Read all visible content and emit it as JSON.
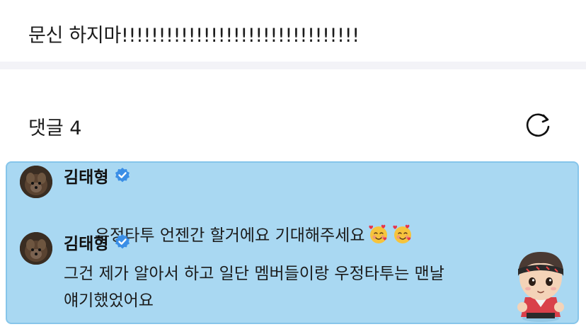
{
  "post": {
    "text": "문신 하지마!!!!!!!!!!!!!!!!!!!!!!!!!!!!!!!!"
  },
  "comments": {
    "title": "댓글 4",
    "refresh_icon": "refresh-icon",
    "items": [
      {
        "author": "김태형",
        "verified": true,
        "text": "우정타투 언젠간 할거에요 기대해주세요",
        "emoji": [
          "smiling-face-with-hearts",
          "smiling-face-with-hearts"
        ]
      },
      {
        "author": "김태형",
        "verified": true,
        "text": "그건 제가 알아서 하고 일단 멤버들이랑 우정타투는 맨날\n얘기했었어요",
        "sticker": "character-sticker"
      }
    ]
  },
  "colors": {
    "highlight_bg": "#a9d8f2",
    "highlight_border": "#86c5ea",
    "verified_blue": "#3a8ee6"
  }
}
